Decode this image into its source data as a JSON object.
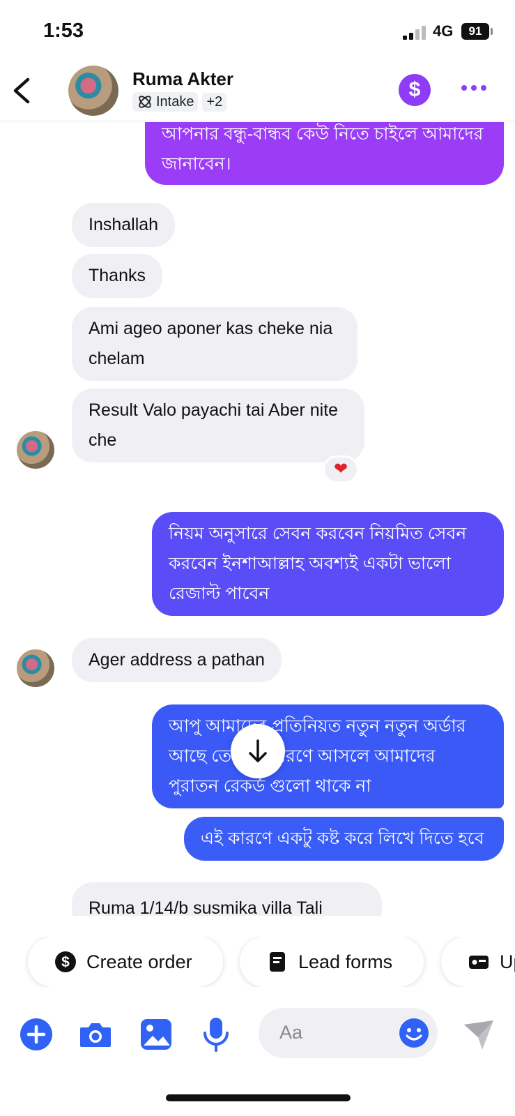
{
  "status_bar": {
    "time": "1:53",
    "network": "4G",
    "battery": "91"
  },
  "header": {
    "contact_name": "Ruma Akter",
    "tag_label": "Intake",
    "tag_more": "+2",
    "pay_icon": "dollar-icon",
    "colors": {
      "accent": "#8e3cf7"
    }
  },
  "messages": [
    {
      "dir": "out",
      "text": "আপনার বন্ধু-বান্ধব কেউ নিতে চাইলে আমাদের জানাবেন।",
      "color": "#9b3cf6"
    },
    {
      "dir": "in",
      "text": "Inshallah"
    },
    {
      "dir": "in",
      "text": "Thanks"
    },
    {
      "dir": "in",
      "text": "Ami ageo aponer kas cheke nia chelam"
    },
    {
      "dir": "in",
      "text": "Result Valo payachi tai Aber nite che",
      "reaction": "❤"
    },
    {
      "dir": "out",
      "text": "নিয়ম অনুসারে সেবন করবেন নিয়মিত সেবন করবেন ইনশাআল্লাহ অবশ্যই একটা ভালো রেজাল্ট পাবেন",
      "color": "#5a4cf6"
    },
    {
      "dir": "in",
      "text": "Ager address a pathan"
    },
    {
      "dir": "out",
      "text": "আপু আমাদের প্রতিনিয়ত নতুন নতুন অর্ডার আছে তো এই কারণে আসলে আমাদের পুরাতন রেকর্ড গুলো থাকে না",
      "color": "#3a59f7"
    },
    {
      "dir": "out",
      "text": "এই কারণে একটু কষ্ট করে লিখে দিতে হবে",
      "color": "#3a5cf7"
    },
    {
      "dir": "in",
      "text": "Ruma 1/14/b susmika villa Tali"
    }
  ],
  "chips": {
    "create_order": "Create order",
    "lead_forms": "Lead forms",
    "third": "Up"
  },
  "composer": {
    "placeholder": "Aa"
  }
}
